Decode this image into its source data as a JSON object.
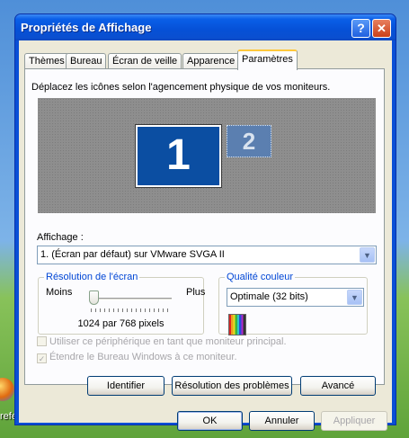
{
  "desktop": {
    "icon_label": "refe"
  },
  "window": {
    "title": "Propriétés de Affichage",
    "help_glyph": "?",
    "close_glyph": "✕"
  },
  "tabs": [
    "Thèmes",
    "Bureau",
    "Écran de veille",
    "Apparence",
    "Paramètres"
  ],
  "active_tab": "Paramètres",
  "settings": {
    "instruction": "Déplacez les icônes selon l'agencement physique de vos moniteurs.",
    "monitor_primary": "1",
    "monitor_secondary": "2",
    "display_label": "Affichage :",
    "display_value": "1. (Écran par défaut) sur VMware SVGA II",
    "resolution_group": "Résolution de l'écran",
    "less_label": "Moins",
    "more_label": "Plus",
    "resolution_value": "1024 par 768 pixels",
    "resolution_slider_level": 0.0,
    "color_group": "Qualité couleur",
    "color_value": "Optimale (32 bits)",
    "check_primary": "Utiliser ce périphérique en tant que moniteur principal.",
    "check_extend": "Étendre le Bureau Windows à ce moniteur.",
    "btn_identify": "Identifier",
    "btn_troubleshoot": "Résolution des problèmes",
    "btn_advanced": "Avancé"
  },
  "footer": {
    "ok": "OK",
    "cancel": "Annuler",
    "apply": "Appliquer"
  },
  "dropdown_arrow": "▼",
  "check_mark": "✓",
  "colors": {
    "titlebar": "#0650d6",
    "dialog_bg": "#ece9d8",
    "monitor_primary": "#0b4ea2",
    "group_legend": "#0046d5"
  }
}
